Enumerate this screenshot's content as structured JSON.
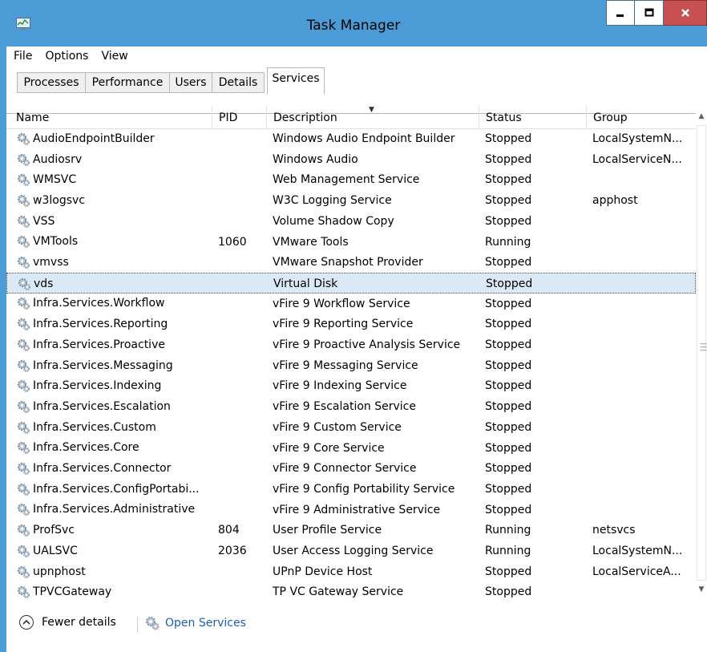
{
  "window": {
    "title": "Task Manager"
  },
  "menu": [
    "File",
    "Options",
    "View"
  ],
  "tabs": [
    "Processes",
    "Performance",
    "Users",
    "Details",
    "Services"
  ],
  "active_tab": "Services",
  "columns": {
    "name": "Name",
    "pid": "PID",
    "description": "Description",
    "status": "Status",
    "group": "Group"
  },
  "sort": {
    "column": "description",
    "direction": "descending"
  },
  "services": [
    {
      "name": "AudioEndpointBuilder",
      "pid": "",
      "description": "Windows Audio Endpoint Builder",
      "status": "Stopped",
      "group": "LocalSystemN..."
    },
    {
      "name": "Audiosrv",
      "pid": "",
      "description": "Windows Audio",
      "status": "Stopped",
      "group": "LocalServiceN..."
    },
    {
      "name": "WMSVC",
      "pid": "",
      "description": "Web Management Service",
      "status": "Stopped",
      "group": ""
    },
    {
      "name": "w3logsvc",
      "pid": "",
      "description": "W3C Logging Service",
      "status": "Stopped",
      "group": "apphost"
    },
    {
      "name": "VSS",
      "pid": "",
      "description": "Volume Shadow Copy",
      "status": "Stopped",
      "group": ""
    },
    {
      "name": "VMTools",
      "pid": "1060",
      "description": "VMware Tools",
      "status": "Running",
      "group": ""
    },
    {
      "name": "vmvss",
      "pid": "",
      "description": "VMware Snapshot Provider",
      "status": "Stopped",
      "group": ""
    },
    {
      "name": "vds",
      "pid": "",
      "description": "Virtual Disk",
      "status": "Stopped",
      "group": "",
      "selected": true
    },
    {
      "name": "Infra.Services.Workflow",
      "pid": "",
      "description": "vFire 9 Workflow Service",
      "status": "Stopped",
      "group": ""
    },
    {
      "name": "Infra.Services.Reporting",
      "pid": "",
      "description": "vFire 9 Reporting Service",
      "status": "Stopped",
      "group": ""
    },
    {
      "name": "Infra.Services.Proactive",
      "pid": "",
      "description": "vFire 9 Proactive Analysis Service",
      "status": "Stopped",
      "group": ""
    },
    {
      "name": "Infra.Services.Messaging",
      "pid": "",
      "description": "vFire 9 Messaging Service",
      "status": "Stopped",
      "group": ""
    },
    {
      "name": "Infra.Services.Indexing",
      "pid": "",
      "description": "vFire 9 Indexing Service",
      "status": "Stopped",
      "group": ""
    },
    {
      "name": "Infra.Services.Escalation",
      "pid": "",
      "description": "vFire 9 Escalation Service",
      "status": "Stopped",
      "group": ""
    },
    {
      "name": "Infra.Services.Custom",
      "pid": "",
      "description": "vFire 9 Custom Service",
      "status": "Stopped",
      "group": ""
    },
    {
      "name": "Infra.Services.Core",
      "pid": "",
      "description": "vFire 9 Core Service",
      "status": "Stopped",
      "group": ""
    },
    {
      "name": "Infra.Services.Connector",
      "pid": "",
      "description": "vFire 9 Connector Service",
      "status": "Stopped",
      "group": ""
    },
    {
      "name": "Infra.Services.ConfigPortabi...",
      "pid": "",
      "description": "vFire 9 Config Portability Service",
      "status": "Stopped",
      "group": ""
    },
    {
      "name": "Infra.Services.Administrative",
      "pid": "",
      "description": "vFire 9 Administrative Service",
      "status": "Stopped",
      "group": ""
    },
    {
      "name": "ProfSvc",
      "pid": "804",
      "description": "User Profile Service",
      "status": "Running",
      "group": "netsvcs"
    },
    {
      "name": "UALSVC",
      "pid": "2036",
      "description": "User Access Logging Service",
      "status": "Running",
      "group": "LocalSystemN..."
    },
    {
      "name": "upnphost",
      "pid": "",
      "description": "UPnP Device Host",
      "status": "Stopped",
      "group": "LocalServiceA..."
    },
    {
      "name": "TPVCGateway",
      "pid": "",
      "description": "TP VC Gateway Service",
      "status": "Stopped",
      "group": ""
    }
  ],
  "footer": {
    "fewer_details": "Fewer details",
    "open_services": "Open Services"
  },
  "icons": {
    "service": "gear-icon",
    "window": "task-manager-icon"
  },
  "colors": {
    "titlebar": "#4a9bd6",
    "close_button": "#c75050",
    "selection": "#dbe8f6",
    "link": "#1a5fb4"
  }
}
